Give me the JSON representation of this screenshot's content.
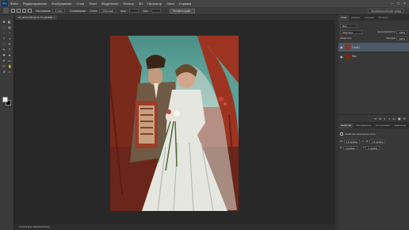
{
  "app": {
    "logo": "Ps"
  },
  "menu": [
    "Файл",
    "Редактирование",
    "Изображение",
    "Слои",
    "Текст",
    "Выделение",
    "Фильтр",
    "3D",
    "Просмотр",
    "Окно",
    "Справка"
  ],
  "window_buttons": [
    "–",
    "□",
    "×"
  ],
  "options": {
    "feather_label": "Растушевка:",
    "feather_value": "0 пикс",
    "antialias_label": "Сглаживание",
    "style_label": "Стиль:",
    "style_value": "Обычный",
    "width_label": "Шир.:",
    "height_label": "Выс.:",
    "refine_button": "Уточнить край...",
    "workspace": "Основная рабочая среда"
  },
  "document": {
    "tab_label": "20_0ff 8f 73f3 @ 16,7% (RGB/8) ×",
    "status": "16,67%      Док: 188,5M/175,0M"
  },
  "toolbar": {
    "tools": [
      "move-tool-icon",
      "marquee-tool-icon",
      "lasso-tool-icon",
      "quick-select-tool-icon",
      "crop-tool-icon",
      "eyedropper-tool-icon",
      "healing-brush-icon",
      "brush-tool-icon",
      "clone-stamp-icon",
      "history-brush-icon",
      "eraser-tool-icon",
      "gradient-tool-icon",
      "blur-tool-icon",
      "dodge-tool-icon",
      "pen-tool-icon",
      "type-tool-icon",
      "path-select-icon",
      "shape-tool-icon",
      "hand-tool-icon",
      "zoom-tool-icon"
    ],
    "glyphs": [
      "✥",
      "⬚",
      "◌",
      "⌇",
      "⛶",
      "✎",
      "✚",
      "✐",
      "⎔",
      "↺",
      "◧",
      "▤",
      "◔",
      "◑",
      "✒",
      "T",
      "➤",
      "▭",
      "✋",
      "⌕"
    ],
    "fg_color": "#f0f0f0",
    "bg_color": "#0a0a0a"
  },
  "layers_panel": {
    "tabs": [
      "Слои",
      "Каналы",
      "Контуры",
      "История"
    ],
    "kind_label": "Вид",
    "blend_mode": "Обычные",
    "opacity_label": "Непрозрачность:",
    "opacity_value": "100%",
    "lock_label": "Закрепить:",
    "fill_label": "Заливка:",
    "fill_value": "100%",
    "layers": [
      {
        "name": "Слой 1"
      },
      {
        "name": "Фон"
      }
    ],
    "footer_icons": [
      "link-icon",
      "fx-icon",
      "mask-icon",
      "adjustment-icon",
      "folder-icon",
      "new-layer-icon",
      "trash-icon"
    ],
    "footer_glyphs": [
      "∞",
      "fx",
      "◐",
      "◑",
      "▭",
      "▣",
      "🗑"
    ]
  },
  "props_panel": {
    "tabs": [
      "Свойства",
      "Инструменты",
      "Гистограмма",
      "Навигатор"
    ],
    "title": "Свойства пиксельного слоя",
    "w_label": "Ш:",
    "w_value": "9,6 дюйма",
    "h_label": "В:",
    "h_value": "7,8 дюйма",
    "x_label": "X:",
    "x_value": "0 дюйма",
    "y_label": "Y:",
    "y_value": "0 дюйма"
  }
}
